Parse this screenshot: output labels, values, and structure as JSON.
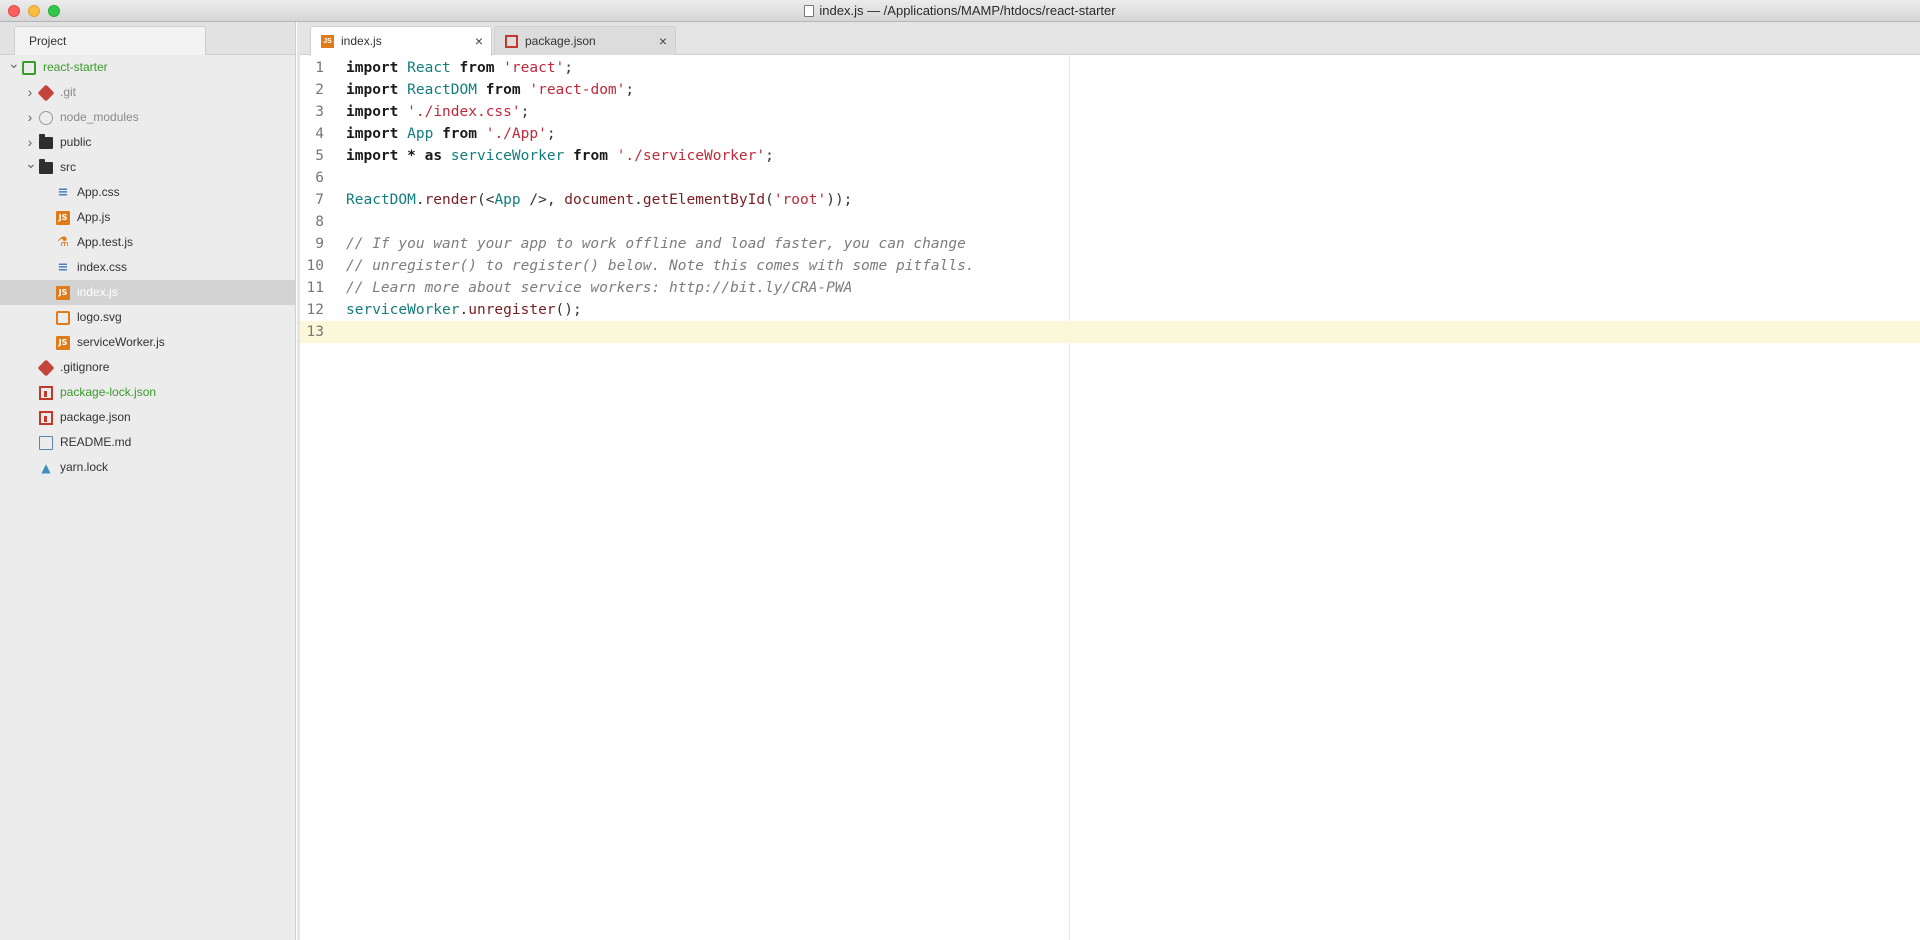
{
  "window": {
    "title": "index.js — /Applications/MAMP/htdocs/react-starter"
  },
  "sidebar": {
    "tab_label": "Project",
    "tree": [
      {
        "label": "react-starter",
        "depth": 0,
        "chevron": "down",
        "icon": "repo-icon",
        "style": "green"
      },
      {
        "label": ".git",
        "depth": 1,
        "chevron": "right",
        "icon": "git-icon",
        "style": "gray"
      },
      {
        "label": "node_modules",
        "depth": 1,
        "chevron": "right",
        "icon": "node-icon",
        "style": "gray"
      },
      {
        "label": "public",
        "depth": 1,
        "chevron": "right",
        "icon": "folder-icon",
        "style": "normal"
      },
      {
        "label": "src",
        "depth": 1,
        "chevron": "down",
        "icon": "folder-icon",
        "style": "normal"
      },
      {
        "label": "App.css",
        "depth": 2,
        "chevron": "",
        "icon": "css-file-icon",
        "style": "normal"
      },
      {
        "label": "App.js",
        "depth": 2,
        "chevron": "",
        "icon": "js-file-icon",
        "style": "normal"
      },
      {
        "label": "App.test.js",
        "depth": 2,
        "chevron": "",
        "icon": "test-file-icon",
        "style": "normal"
      },
      {
        "label": "index.css",
        "depth": 2,
        "chevron": "",
        "icon": "css-file-icon",
        "style": "normal"
      },
      {
        "label": "index.js",
        "depth": 2,
        "chevron": "",
        "icon": "js-file-icon",
        "style": "selected"
      },
      {
        "label": "logo.svg",
        "depth": 2,
        "chevron": "",
        "icon": "svg-file-icon",
        "style": "normal"
      },
      {
        "label": "serviceWorker.js",
        "depth": 2,
        "chevron": "",
        "icon": "js-file-icon",
        "style": "normal"
      },
      {
        "label": ".gitignore",
        "depth": 1,
        "chevron": "",
        "icon": "git-icon",
        "style": "normal"
      },
      {
        "label": "package-lock.json",
        "depth": 1,
        "chevron": "",
        "icon": "package-icon",
        "style": "green"
      },
      {
        "label": "package.json",
        "depth": 1,
        "chevron": "",
        "icon": "package-icon",
        "style": "normal"
      },
      {
        "label": "README.md",
        "depth": 1,
        "chevron": "",
        "icon": "markdown-icon",
        "style": "normal"
      },
      {
        "label": "yarn.lock",
        "depth": 1,
        "chevron": "",
        "icon": "yarn-icon",
        "style": "normal"
      }
    ]
  },
  "editor": {
    "tabs": [
      {
        "label": "index.js",
        "icon": "js-file-icon",
        "active": true,
        "close": "×"
      },
      {
        "label": "package.json",
        "icon": "package-icon",
        "active": false,
        "close": "×"
      }
    ],
    "current_line": 13,
    "lines": [
      [
        [
          "kw",
          "import"
        ],
        [
          "pl",
          " "
        ],
        [
          "id",
          "React"
        ],
        [
          "pl",
          " "
        ],
        [
          "kw",
          "from"
        ],
        [
          "pl",
          " "
        ],
        [
          "str",
          "'react'"
        ],
        [
          "pl",
          ";"
        ]
      ],
      [
        [
          "kw",
          "import"
        ],
        [
          "pl",
          " "
        ],
        [
          "id",
          "ReactDOM"
        ],
        [
          "pl",
          " "
        ],
        [
          "kw",
          "from"
        ],
        [
          "pl",
          " "
        ],
        [
          "str",
          "'react-dom'"
        ],
        [
          "pl",
          ";"
        ]
      ],
      [
        [
          "kw",
          "import"
        ],
        [
          "pl",
          " "
        ],
        [
          "str",
          "'./index.css'"
        ],
        [
          "pl",
          ";"
        ]
      ],
      [
        [
          "kw",
          "import"
        ],
        [
          "pl",
          " "
        ],
        [
          "id",
          "App"
        ],
        [
          "pl",
          " "
        ],
        [
          "kw",
          "from"
        ],
        [
          "pl",
          " "
        ],
        [
          "str",
          "'./App'"
        ],
        [
          "pl",
          ";"
        ]
      ],
      [
        [
          "kw",
          "import"
        ],
        [
          "pl",
          " "
        ],
        [
          "kw",
          "*"
        ],
        [
          "pl",
          " "
        ],
        [
          "kw",
          "as"
        ],
        [
          "pl",
          " "
        ],
        [
          "id",
          "serviceWorker"
        ],
        [
          "pl",
          " "
        ],
        [
          "kw",
          "from"
        ],
        [
          "pl",
          " "
        ],
        [
          "str",
          "'./serviceWorker'"
        ],
        [
          "pl",
          ";"
        ]
      ],
      [],
      [
        [
          "id",
          "ReactDOM"
        ],
        [
          "pl",
          "."
        ],
        [
          "fn",
          "render"
        ],
        [
          "pl",
          "(<"
        ],
        [
          "id",
          "App"
        ],
        [
          "pl",
          " />, "
        ],
        [
          "fn",
          "document"
        ],
        [
          "pl",
          "."
        ],
        [
          "fn",
          "getElementById"
        ],
        [
          "pl",
          "("
        ],
        [
          "str",
          "'root'"
        ],
        [
          "pl",
          "));"
        ]
      ],
      [],
      [
        [
          "cm",
          "// If you want your app to work offline and load faster, you can change"
        ]
      ],
      [
        [
          "cm",
          "// unregister() to register() below. Note this comes with some pitfalls."
        ]
      ],
      [
        [
          "cm",
          "// Learn more about service workers: http://bit.ly/CRA-PWA"
        ]
      ],
      [
        [
          "id",
          "serviceWorker"
        ],
        [
          "pl",
          "."
        ],
        [
          "fn",
          "unregister"
        ],
        [
          "pl",
          "();"
        ]
      ],
      []
    ]
  }
}
